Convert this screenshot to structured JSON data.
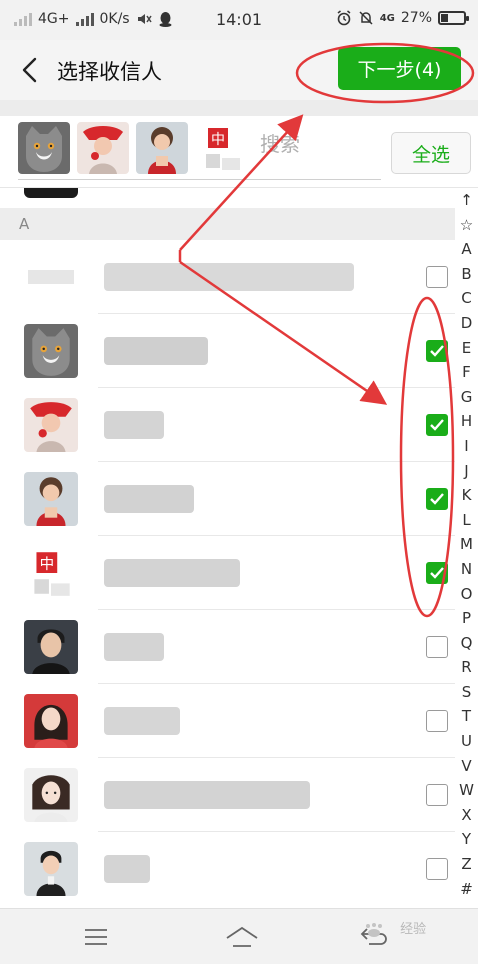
{
  "status_bar": {
    "network": "4G+",
    "speed": "0K/s",
    "time": "14:01",
    "network_right": "4G",
    "battery": "27%"
  },
  "header": {
    "title": "选择收信人",
    "next_button": "下一步(4)"
  },
  "selected_strip": {
    "avatars": [
      "cat-avatar",
      "baby-red-avatar",
      "child-avatar",
      "seal-avatar"
    ],
    "search_placeholder": "搜索",
    "select_all": "全选"
  },
  "section": {
    "label": "A"
  },
  "contacts": [
    {
      "avatar": "blurred",
      "checked": false
    },
    {
      "avatar": "cat",
      "checked": true
    },
    {
      "avatar": "baby-red",
      "checked": true
    },
    {
      "avatar": "child",
      "checked": true
    },
    {
      "avatar": "seal",
      "checked": true
    },
    {
      "avatar": "man",
      "checked": false
    },
    {
      "avatar": "woman",
      "checked": false
    },
    {
      "avatar": "woman-hat",
      "checked": false
    },
    {
      "avatar": "boy",
      "checked": false
    }
  ],
  "alphabet": [
    "↑",
    "☆",
    "A",
    "B",
    "C",
    "D",
    "E",
    "F",
    "G",
    "H",
    "I",
    "J",
    "K",
    "L",
    "M",
    "N",
    "O",
    "P",
    "Q",
    "R",
    "S",
    "T",
    "U",
    "V",
    "W",
    "X",
    "Y",
    "Z",
    "#"
  ],
  "watermark": "经验",
  "colors": {
    "accent_green": "#1aad19",
    "annotation_red": "#e2393a"
  }
}
